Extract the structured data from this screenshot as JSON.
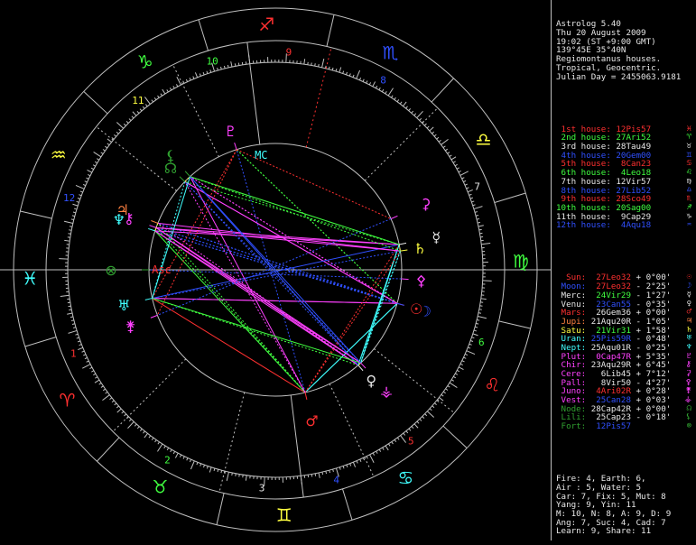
{
  "header": {
    "lines": [
      "Astrolog 5.40",
      "Thu 20 August 2009",
      "19:02 (ST +9:00 GMT)",
      "139°45E 35°40N",
      "Regiomontanus houses.",
      "Tropical, Geocentric.",
      "Julian Day = 2455063.9181"
    ]
  },
  "houses": [
    {
      "label": "1st house:",
      "value": "12Pis57",
      "glyph": "♓",
      "color": "#ff3030"
    },
    {
      "label": "2nd house:",
      "value": "27Ari52",
      "glyph": "♈",
      "color": "#40ff40"
    },
    {
      "label": "3rd house:",
      "value": "28Tau49",
      "glyph": "♉",
      "color": "#e8e8e8"
    },
    {
      "label": "4th house:",
      "value": "20Gem00",
      "glyph": "♊",
      "color": "#3050ff"
    },
    {
      "label": "5th house:",
      "value": "8Can23",
      "glyph": "♋",
      "color": "#ff3030"
    },
    {
      "label": "6th house:",
      "value": "4Leo18",
      "glyph": "♌",
      "color": "#40ff40"
    },
    {
      "label": "7th house:",
      "value": "12Vir57",
      "glyph": "♍",
      "color": "#e8e8e8"
    },
    {
      "label": "8th house:",
      "value": "27Lib52",
      "glyph": "♎",
      "color": "#3050ff"
    },
    {
      "label": "9th house:",
      "value": "28Sco49",
      "glyph": "♏",
      "color": "#ff3030"
    },
    {
      "label": "10th house:",
      "value": "20Sag00",
      "glyph": "♐",
      "color": "#40ff40"
    },
    {
      "label": "11th house:",
      "value": "9Cap29",
      "glyph": "♑",
      "color": "#e8e8e8"
    },
    {
      "label": "12th house:",
      "value": "4Aqu18",
      "glyph": "♒",
      "color": "#3050ff"
    }
  ],
  "planets": [
    {
      "name": "Sun:",
      "pos": "27Leo32",
      "lat": "+ 0°00'",
      "glyph": "☉",
      "color": "#ff3030",
      "posColor": "#ff3030"
    },
    {
      "name": "Moon:",
      "pos": "27Leo32",
      "lat": "- 2°25'",
      "glyph": "☽",
      "color": "#3050ff",
      "posColor": "#ff3030"
    },
    {
      "name": "Merc:",
      "pos": "24Vir29",
      "lat": "- 1°27'",
      "glyph": "☿",
      "color": "#e8e8e8",
      "posColor": "#40ff40"
    },
    {
      "name": "Venu:",
      "pos": "23Can55",
      "lat": "- 0°35'",
      "glyph": "♀",
      "color": "#e8e8e8",
      "posColor": "#3050ff"
    },
    {
      "name": "Mars:",
      "pos": "26Gem36",
      "lat": "+ 0°00'",
      "glyph": "♂",
      "color": "#ff3030",
      "posColor": "#e8e8e8"
    },
    {
      "name": "Jupi:",
      "pos": "21Aqu20R",
      "lat": "- 1°05'",
      "glyph": "♃",
      "color": "#ff8040",
      "posColor": "#e8e8e8"
    },
    {
      "name": "Satu:",
      "pos": "21Vir31",
      "lat": "+ 1°58'",
      "glyph": "♄",
      "color": "#ffff40",
      "posColor": "#40ff40"
    },
    {
      "name": "Uran:",
      "pos": "25Pis59R",
      "lat": "- 0°48'",
      "glyph": "♅",
      "color": "#40ffff",
      "posColor": "#3050ff"
    },
    {
      "name": "Nept:",
      "pos": "25Aqu01R",
      "lat": "- 0°25'",
      "glyph": "♆",
      "color": "#40ffff",
      "posColor": "#e8e8e8"
    },
    {
      "name": "Plut:",
      "pos": "0Cap47R",
      "lat": "+ 5°35'",
      "glyph": "♇",
      "color": "#ff40ff",
      "posColor": "#ff40ff"
    },
    {
      "name": "Chir:",
      "pos": "23Aqu29R",
      "lat": "+ 6°45'",
      "glyph": "⚷",
      "color": "#ff40ff",
      "posColor": "#e8e8e8"
    },
    {
      "name": "Cere:",
      "pos": "6Lib45",
      "lat": "+ 7°12'",
      "glyph": "⚳",
      "color": "#ff40ff",
      "posColor": "#e8e8e8"
    },
    {
      "name": "Pall:",
      "pos": "8Vir50",
      "lat": "- 4°27'",
      "glyph": "⚴",
      "color": "#ff40ff",
      "posColor": "#e8e8e8"
    },
    {
      "name": "Juno:",
      "pos": "4Ari02R",
      "lat": "+ 0°28'",
      "glyph": "⚵",
      "color": "#ff40ff",
      "posColor": "#ff3030"
    },
    {
      "name": "Vest:",
      "pos": "25Can28",
      "lat": "+ 0°03'",
      "glyph": "⚶",
      "color": "#ff40ff",
      "posColor": "#3050ff"
    },
    {
      "name": "Node:",
      "pos": "28Cap42R",
      "lat": "+ 0°00'",
      "glyph": "☊",
      "color": "#30a030",
      "posColor": "#e8e8e8"
    },
    {
      "name": "Lili:",
      "pos": "25Cap23",
      "lat": "- 0°18'",
      "glyph": "⚸",
      "color": "#30a030",
      "posColor": "#e8e8e8"
    },
    {
      "name": "Fort:",
      "pos": "12Pis57",
      "lat": "",
      "glyph": "⊗",
      "color": "#30a030",
      "posColor": "#3050ff"
    }
  ],
  "stats": [
    "Fire: 4, Earth: 6,",
    "Air : 5, Water: 5",
    "Car: 7, Fix: 5, Mut: 8",
    "Yang: 9, Yin: 11",
    "M: 10, N: 8, A: 9, D: 9",
    "Ang: 7, Suc: 4, Cad: 7",
    "Learn: 9, Share: 11"
  ],
  "wheel": {
    "house_numbers": [
      "1",
      "2",
      "3",
      "4",
      "5",
      "6",
      "7",
      "8",
      "9",
      "10",
      "11",
      "12"
    ],
    "asc_label": "Asc",
    "mc_label": "MC",
    "signs": [
      "♓",
      "♈",
      "♉",
      "♊",
      "♋",
      "♌",
      "♍",
      "♎",
      "♏",
      "♐",
      "♑",
      "♒"
    ],
    "sign_colors": [
      "#40ffff",
      "#ff3030",
      "#40ff40",
      "#ffff40",
      "#40ffff",
      "#ff3030",
      "#40ff40",
      "#ffff40",
      "#3050ff",
      "#ff3030",
      "#40ff40",
      "#ffff40"
    ]
  }
}
